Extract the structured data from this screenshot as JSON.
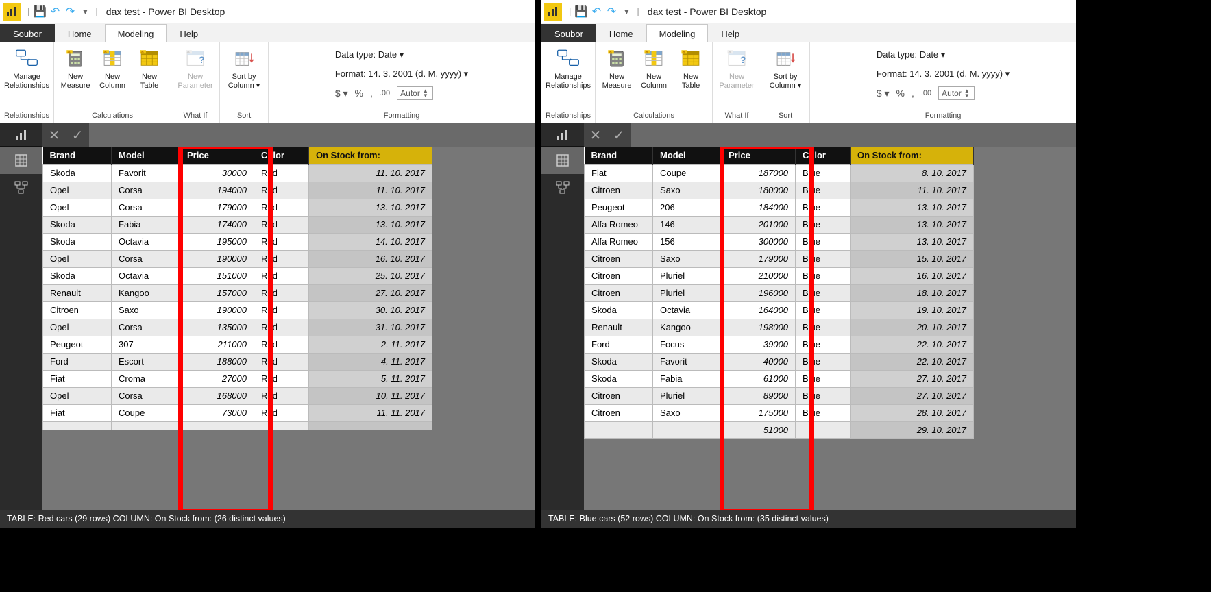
{
  "left": {
    "title": "dax test - Power BI Desktop",
    "tabs": {
      "file": "Soubor",
      "home": "Home",
      "modeling": "Modeling",
      "help": "Help"
    },
    "ribbon": {
      "relationships": {
        "group": "Relationships",
        "btn": "Manage\nRelationships"
      },
      "calculations": {
        "group": "Calculations",
        "measure": "New\nMeasure",
        "column": "New\nColumn",
        "table": "New\nTable"
      },
      "whatif": {
        "group": "What If",
        "btn": "New\nParameter"
      },
      "sort": {
        "group": "Sort",
        "btn": "Sort by\nColumn ▾"
      },
      "formatting": {
        "group": "Formatting",
        "datatype": "Data type: Date ▾",
        "format": "Format: 14. 3. 2001 (d. M. yyyy) ▾",
        "dollar": "$ ▾",
        "pct": "%",
        "comma": ",",
        "dec": ".00",
        "auto": "Autor"
      }
    },
    "table": {
      "headers": [
        "Brand",
        "Model",
        "Price",
        "Color",
        "On Stock from:"
      ],
      "rows": [
        [
          "Skoda",
          "Favorit",
          "30000",
          "Red",
          "11. 10. 2017"
        ],
        [
          "Opel",
          "Corsa",
          "194000",
          "Red",
          "11. 10. 2017"
        ],
        [
          "Opel",
          "Corsa",
          "179000",
          "Red",
          "13. 10. 2017"
        ],
        [
          "Skoda",
          "Fabia",
          "174000",
          "Red",
          "13. 10. 2017"
        ],
        [
          "Skoda",
          "Octavia",
          "195000",
          "Red",
          "14. 10. 2017"
        ],
        [
          "Opel",
          "Corsa",
          "190000",
          "Red",
          "16. 10. 2017"
        ],
        [
          "Skoda",
          "Octavia",
          "151000",
          "Red",
          "25. 10. 2017"
        ],
        [
          "Renault",
          "Kangoo",
          "157000",
          "Red",
          "27. 10. 2017"
        ],
        [
          "Citroen",
          "Saxo",
          "190000",
          "Red",
          "30. 10. 2017"
        ],
        [
          "Opel",
          "Corsa",
          "135000",
          "Red",
          "31. 10. 2017"
        ],
        [
          "Peugeot",
          "307",
          "211000",
          "Red",
          "2. 11. 2017"
        ],
        [
          "Ford",
          "Escort",
          "188000",
          "Red",
          "4. 11. 2017"
        ],
        [
          "Fiat",
          "Croma",
          "27000",
          "Red",
          "5. 11. 2017"
        ],
        [
          "Opel",
          "Corsa",
          "168000",
          "Red",
          "10. 11. 2017"
        ],
        [
          "Fiat",
          "Coupe",
          "73000",
          "Red",
          "11. 11. 2017"
        ]
      ],
      "partial": [
        "",
        "",
        "",
        "",
        ""
      ]
    },
    "status": "TABLE: Red cars (29 rows) COLUMN: On Stock from: (26 distinct values)"
  },
  "right": {
    "title": "dax test - Power BI Desktop",
    "tabs": {
      "file": "Soubor",
      "home": "Home",
      "modeling": "Modeling",
      "help": "Help"
    },
    "ribbon": {
      "relationships": {
        "group": "Relationships",
        "btn": "Manage\nRelationships"
      },
      "calculations": {
        "group": "Calculations",
        "measure": "New\nMeasure",
        "column": "New\nColumn",
        "table": "New\nTable"
      },
      "whatif": {
        "group": "What If",
        "btn": "New\nParameter"
      },
      "sort": {
        "group": "Sort",
        "btn": "Sort by\nColumn ▾"
      },
      "formatting": {
        "group": "Formatting",
        "datatype": "Data type: Date ▾",
        "format": "Format: 14. 3. 2001 (d. M. yyyy) ▾",
        "dollar": "$ ▾",
        "pct": "%",
        "comma": ",",
        "dec": ".00",
        "auto": "Autor"
      }
    },
    "table": {
      "headers": [
        "Brand",
        "Model",
        "Price",
        "Color",
        "On Stock from:"
      ],
      "rows": [
        [
          "Fiat",
          "Coupe",
          "187000",
          "Blue",
          "8. 10. 2017"
        ],
        [
          "Citroen",
          "Saxo",
          "180000",
          "Blue",
          "11. 10. 2017"
        ],
        [
          "Peugeot",
          "206",
          "184000",
          "Blue",
          "13. 10. 2017"
        ],
        [
          "Alfa Romeo",
          "146",
          "201000",
          "Blue",
          "13. 10. 2017"
        ],
        [
          "Alfa Romeo",
          "156",
          "300000",
          "Blue",
          "13. 10. 2017"
        ],
        [
          "Citroen",
          "Saxo",
          "179000",
          "Blue",
          "15. 10. 2017"
        ],
        [
          "Citroen",
          "Pluriel",
          "210000",
          "Blue",
          "16. 10. 2017"
        ],
        [
          "Citroen",
          "Pluriel",
          "196000",
          "Blue",
          "18. 10. 2017"
        ],
        [
          "Skoda",
          "Octavia",
          "164000",
          "Blue",
          "19. 10. 2017"
        ],
        [
          "Renault",
          "Kangoo",
          "198000",
          "Blue",
          "20. 10. 2017"
        ],
        [
          "Ford",
          "Focus",
          "39000",
          "Blue",
          "22. 10. 2017"
        ],
        [
          "Skoda",
          "Favorit",
          "40000",
          "Blue",
          "22. 10. 2017"
        ],
        [
          "Skoda",
          "Fabia",
          "61000",
          "Blue",
          "27. 10. 2017"
        ],
        [
          "Citroen",
          "Pluriel",
          "89000",
          "Blue",
          "27. 10. 2017"
        ],
        [
          "Citroen",
          "Saxo",
          "175000",
          "Blue",
          "28. 10. 2017"
        ]
      ],
      "partial": [
        "",
        "",
        "51000",
        "",
        "29. 10. 2017"
      ]
    },
    "status": "TABLE: Blue cars (52 rows) COLUMN: On Stock from: (35 distinct values)"
  }
}
